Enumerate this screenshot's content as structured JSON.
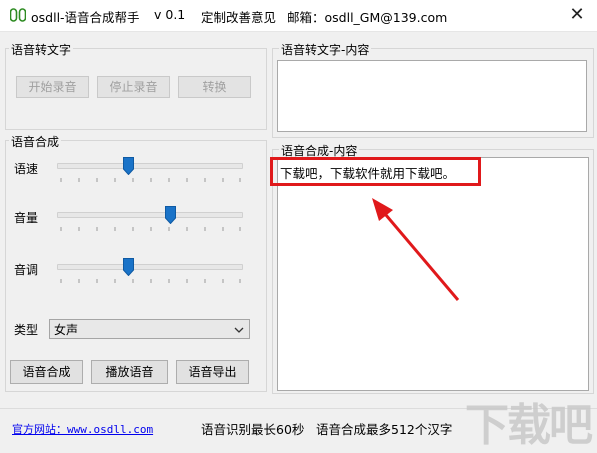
{
  "window": {
    "title": "osdll-语音合成帮手",
    "version": "v 0.1",
    "feedback": "定制改善意见",
    "email": "邮箱：osdll_GM@139.com",
    "close_glyph": "✕"
  },
  "stt_group": {
    "legend": "语音转文字",
    "start_label": "开始录音",
    "stop_label": "停止录音",
    "convert_label": "转换"
  },
  "stt_content": {
    "legend": "语音转文字-内容",
    "text": ""
  },
  "tts_group": {
    "legend": "语音合成",
    "speed_label": "语速",
    "volume_label": "音量",
    "pitch_label": "音调",
    "speed_value": 0.38,
    "volume_value": 0.62,
    "pitch_value": 0.38,
    "type_label": "类型",
    "type_value": "女声",
    "synth_label": "语音合成",
    "play_label": "播放语音",
    "export_label": "语音导出"
  },
  "tts_content": {
    "legend": "语音合成-内容",
    "text": "下载吧，下载软件就用下载吧。"
  },
  "status": {
    "website_label": "官方网站：www.osdll.com",
    "limit_recognition": "语音识别最长60秒",
    "limit_synthesis": "语音合成最多512个汉字"
  },
  "watermark": "下载吧",
  "colors": {
    "annotation_red": "#e0191b",
    "slider_thumb": "#1a73c8",
    "link": "#0000ee"
  }
}
